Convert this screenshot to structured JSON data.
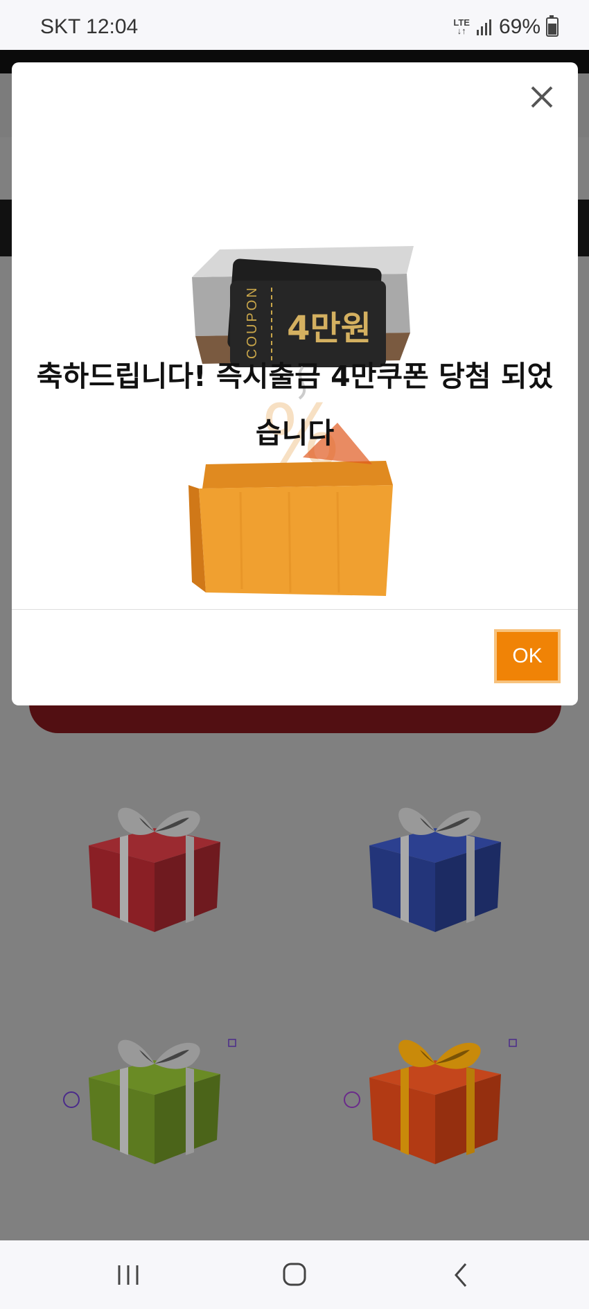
{
  "status_bar": {
    "carrier_time": "SKT 12:04",
    "network": "LTE",
    "battery": "69%"
  },
  "modal": {
    "coupon_side_label": "COUPON",
    "coupon_amount": "4만원",
    "headline_line1": "축하드립니다! 즉시출금 4만쿠폰 당첨 되었",
    "headline_line2": "습니다",
    "ok_label": "OK",
    "close_icon": "close-icon"
  },
  "gifts": [
    {
      "color": "#8a1f25",
      "ribbon": "#a9a9a9"
    },
    {
      "color": "#23357a",
      "ribbon": "#a9a9a9"
    },
    {
      "color": "#5c7a1f",
      "ribbon": "#a9a9a9"
    },
    {
      "color": "#b23a14",
      "ribbon": "#c98a0a"
    }
  ],
  "nav_bar": {
    "icons": [
      "recent-apps-icon",
      "home-icon",
      "back-icon"
    ]
  }
}
